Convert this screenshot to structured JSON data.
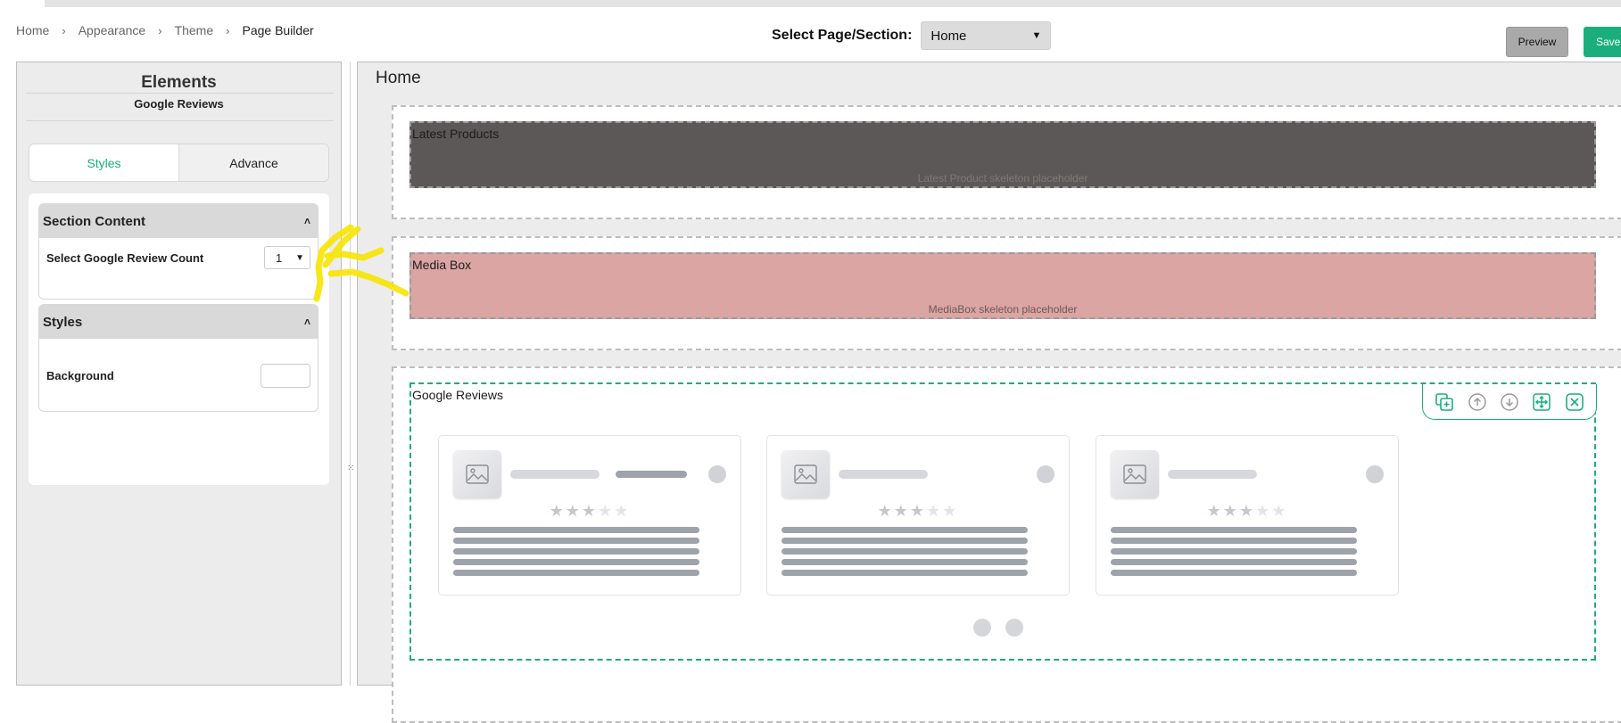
{
  "breadcrumb": {
    "items": [
      {
        "label": "Home"
      },
      {
        "label": "Appearance"
      },
      {
        "label": "Theme"
      },
      {
        "label": "Page Builder"
      }
    ]
  },
  "page_select": {
    "label": "Select Page/Section:",
    "value": "Home"
  },
  "actions": {
    "preview_label": "Preview",
    "save_label": "Save"
  },
  "left_panel": {
    "title": "Elements",
    "subtitle": "Google Reviews",
    "tabs": [
      {
        "label": "Styles",
        "active": true
      },
      {
        "label": "Advance",
        "active": false
      }
    ],
    "sections": [
      {
        "title": "Section Content",
        "field_label": "Select Google Review Count",
        "field_value": "1"
      },
      {
        "title": "Styles",
        "field_label": "Background"
      }
    ]
  },
  "canvas": {
    "title": "Home",
    "blocks": [
      {
        "label": "Latest Products",
        "placeholder": "Latest Product skeleton placeholder"
      },
      {
        "label": "Media Box",
        "placeholder": "MediaBox skeleton placeholder"
      }
    ],
    "google_reviews": {
      "label": "Google Reviews",
      "toolbar_icons": [
        "duplicate-icon",
        "move-up-icon",
        "move-down-icon",
        "drag-move-icon",
        "close-icon"
      ],
      "card_rating": 3,
      "card_rating_max": 5
    }
  },
  "colors": {
    "accent": "#1aae7c",
    "latest_products_bg": "#5c5857",
    "media_box_bg": "#dba5a4",
    "annotation": "#f7e400"
  }
}
